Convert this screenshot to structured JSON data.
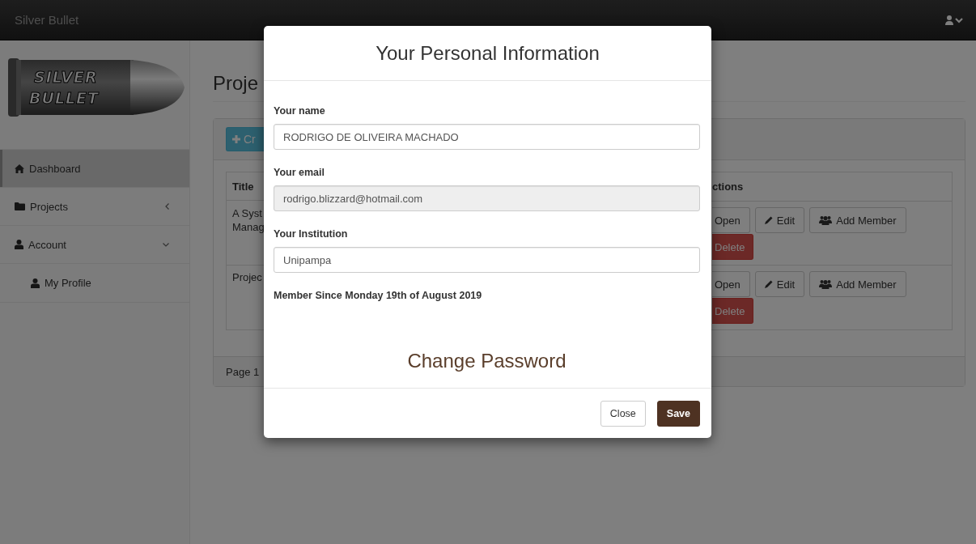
{
  "navbar": {
    "brand": "Silver Bullet"
  },
  "sidebar": {
    "logo_text": [
      "SILVER",
      "BULLET"
    ],
    "items": [
      {
        "label": "Dashboard",
        "selected": true
      },
      {
        "label": "Projects",
        "selected": false,
        "expanded": false
      },
      {
        "label": "Account",
        "selected": false,
        "expanded": true,
        "children": [
          {
            "label": "My Profile",
            "selected": false
          }
        ]
      }
    ]
  },
  "page": {
    "heading": "Proje",
    "create_button": "Cr",
    "table": {
      "columns": [
        "Title",
        "ctions"
      ],
      "rows": [
        {
          "title": [
            "A Syst",
            "Manag"
          ],
          "actions": [
            "Open",
            "Edit",
            "Add Member",
            "Delete"
          ]
        },
        {
          "title": [
            "Projec"
          ],
          "actions": [
            "Open",
            "Edit",
            "Add Member",
            "Delete"
          ]
        }
      ]
    },
    "footer": "Page 1"
  },
  "modal": {
    "title": "Your Personal Information",
    "fields": [
      {
        "label": "Your name",
        "value": "RODRIGO DE OLIVEIRA MACHADO",
        "disabled": false
      },
      {
        "label": "Your email",
        "value": "rodrigo.blizzard@hotmail.com",
        "disabled": true
      },
      {
        "label": "Your Institution",
        "value": "Unipampa",
        "disabled": false
      }
    ],
    "member_since": "Member Since Monday 19th of August 2019",
    "change_password": "Change Password",
    "buttons": [
      {
        "label": "Close",
        "kind": "default"
      },
      {
        "label": "Save",
        "kind": "primary"
      }
    ]
  }
}
